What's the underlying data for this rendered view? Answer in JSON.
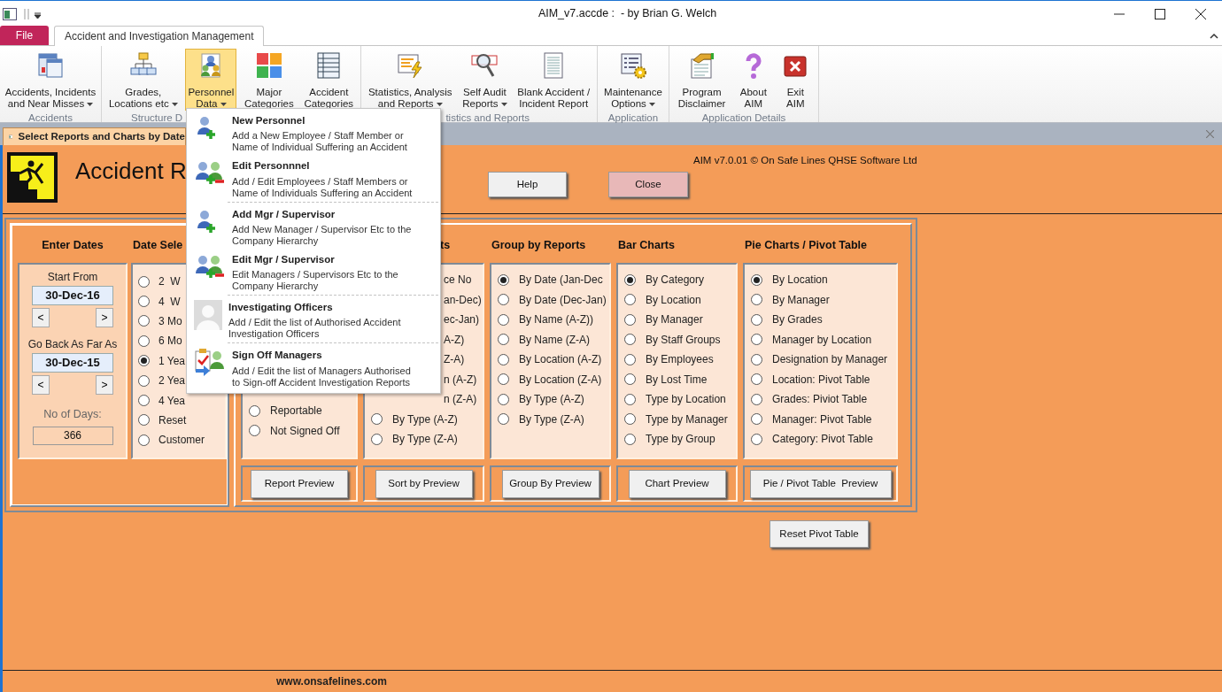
{
  "window": {
    "title": "AIM_v7.accde :  - by Brian G. Welch"
  },
  "ribbon": {
    "file_tab": "File",
    "tab": "Accident and Investigation Management",
    "groups": [
      {
        "label": "Accidents",
        "buttons": [
          {
            "lines": [
              "Accidents, Incidents",
              "and Near Misses"
            ],
            "dropdown": true,
            "selected": false
          }
        ]
      },
      {
        "label": "Structure D",
        "buttons": [
          {
            "lines": [
              "Grades,",
              "Locations etc"
            ],
            "dropdown": true,
            "selected": false
          },
          {
            "lines": [
              "Personnel",
              "Data"
            ],
            "dropdown": true,
            "selected": true,
            "menu": [
              {
                "title": "New Personnel",
                "description": [
                  "Add a New Employee / Staff Member or",
                  "Name of Individual Suffering an Accident"
                ],
                "divider": false
              },
              {
                "title": "Edit Personnnel",
                "description": [
                  "Add / Edit Employees / Staff Members or",
                  "Name of Individuals Suffering an Accident"
                ],
                "divider": true
              },
              {
                "title": "Add Mgr / Supervisor",
                "description": [
                  "Add New Manager / Supervisor Etc to the",
                  "Company Hierarchy"
                ],
                "divider": false
              },
              {
                "title": "Edit Mgr / Supervisor",
                "description": [
                  "Edit Managers / Supervisors Etc to the",
                  "Company Hierarchy"
                ],
                "divider": true
              },
              {
                "title": "Investigating Officers",
                "description": [
                  "Add / Edit the list of Authorised Accident",
                  "Investigation Officers"
                ],
                "divider": true
              },
              {
                "title": "Sign Off Managers",
                "description": [
                  "Add / Edit the list of Managers Authorised",
                  "to Sign-off Accident Investigation Reports"
                ],
                "divider": false
              }
            ]
          },
          {
            "lines": [
              "Major",
              "Categories"
            ],
            "dropdown": false,
            "selected": false
          },
          {
            "lines": [
              "Accident",
              "Categories"
            ],
            "dropdown": false,
            "selected": false
          }
        ]
      },
      {
        "label": "tistics and Reports",
        "buttons": [
          {
            "lines": [
              "Statistics, Analysis",
              "and Reports"
            ],
            "dropdown": true,
            "selected": false
          },
          {
            "lines": [
              "Self Audit",
              "Reports"
            ],
            "dropdown": true,
            "selected": false
          },
          {
            "lines": [
              "Blank Accident /",
              "Incident Report"
            ],
            "dropdown": false,
            "selected": false
          }
        ]
      },
      {
        "label": "Application",
        "buttons": [
          {
            "lines": [
              "Maintenance",
              "Options"
            ],
            "dropdown": true,
            "selected": false
          }
        ]
      },
      {
        "label": "Application Details",
        "buttons": [
          {
            "lines": [
              "Program",
              "Disclaimer"
            ],
            "dropdown": false,
            "selected": false
          },
          {
            "lines": [
              "About",
              "AIM"
            ],
            "dropdown": false,
            "selected": false
          },
          {
            "lines": [
              "Exit",
              "AIM"
            ],
            "dropdown": false,
            "selected": false
          }
        ]
      }
    ]
  },
  "subwindow": {
    "tab": "Select Reports and Charts by Date"
  },
  "form": {
    "title": "Accident R",
    "version": "AIM v7.0.01 © On Safe Lines QHSE Software Ltd",
    "help_button": "Help",
    "close_button": "Close",
    "enter_dates": {
      "heading": "Enter Dates",
      "dates": [
        {
          "label": "Start From",
          "value": "30-Dec-16",
          "prev": "<",
          "next": ">"
        },
        {
          "label": "Go Back As Far As",
          "value": "30-Dec-15",
          "prev": "<",
          "next": ">"
        }
      ],
      "days_label": "No of Days:",
      "days_value": "366"
    },
    "date_select": {
      "heading": "Date Sele",
      "options": [
        {
          "label": "2  W",
          "selected": false
        },
        {
          "label": "4  W",
          "selected": false
        },
        {
          "label": "3 Mo",
          "selected": false
        },
        {
          "label": "6 Mo",
          "selected": false
        },
        {
          "label": "1 Yea",
          "selected": true
        },
        {
          "label": "2 Yea",
          "selected": false
        },
        {
          "label": "4 Yea",
          "selected": false
        },
        {
          "label": "Reset",
          "selected": false
        },
        {
          "label": "Customer",
          "selected": false
        }
      ]
    },
    "columns": [
      {
        "options": [
          {
            "kind": "radio",
            "label": "Reportable",
            "selected": false
          },
          {
            "kind": "radio",
            "label": "Not Signed Off",
            "selected": false
          }
        ],
        "button": "Report Preview"
      },
      {
        "heading": "ts",
        "options": [
          {
            "kind": "cut",
            "label": "ce No"
          },
          {
            "kind": "cut",
            "label": "an-Dec)"
          },
          {
            "kind": "cut",
            "label": "ec-Jan)"
          },
          {
            "kind": "cut",
            "label": "A-Z)"
          },
          {
            "kind": "cut",
            "label": "Z-A)"
          },
          {
            "kind": "cut",
            "label": "n (A-Z)"
          },
          {
            "kind": "cut",
            "label": "n (Z-A)"
          },
          {
            "kind": "radio",
            "label": "By Type (A-Z)",
            "selected": false
          },
          {
            "kind": "radio",
            "label": "By Type (Z-A)",
            "selected": false
          }
        ],
        "button": "Sort by Preview"
      },
      {
        "heading": "Group by Reports",
        "options": [
          {
            "kind": "radio",
            "label": "By Date (Jan-Dec",
            "selected": true
          },
          {
            "kind": "radio",
            "label": "By Date (Dec-Jan)",
            "selected": false
          },
          {
            "kind": "radio",
            "label": "By Name (A-Z))",
            "selected": false
          },
          {
            "kind": "radio",
            "label": "By Name (Z-A)",
            "selected": false
          },
          {
            "kind": "radio",
            "label": "By Location (A-Z)",
            "selected": false
          },
          {
            "kind": "radio",
            "label": "By Location (Z-A)",
            "selected": false
          },
          {
            "kind": "radio",
            "label": "By Type (A-Z)",
            "selected": false
          },
          {
            "kind": "radio",
            "label": "By Type (Z-A)",
            "selected": false
          }
        ],
        "button": "Group By Preview"
      },
      {
        "heading": "Bar Charts",
        "options": [
          {
            "kind": "radio",
            "label": "By Category",
            "selected": true
          },
          {
            "kind": "radio",
            "label": "By Location",
            "selected": false
          },
          {
            "kind": "radio",
            "label": "By Manager",
            "selected": false
          },
          {
            "kind": "radio",
            "label": "By Staff Groups",
            "selected": false
          },
          {
            "kind": "radio",
            "label": "By Employees",
            "selected": false
          },
          {
            "kind": "radio",
            "label": "By Lost Time",
            "selected": false
          },
          {
            "kind": "radio",
            "label": "Type by Location",
            "selected": false
          },
          {
            "kind": "radio",
            "label": "Type by Manager",
            "selected": false
          },
          {
            "kind": "radio",
            "label": "Type by Group",
            "selected": false
          }
        ],
        "button": "Chart Preview"
      },
      {
        "heading": "Pie Charts / Pivot Table",
        "options": [
          {
            "kind": "radio",
            "label": "By Location",
            "selected": true
          },
          {
            "kind": "radio",
            "label": "By Manager",
            "selected": false
          },
          {
            "kind": "radio",
            "label": "By Grades",
            "selected": false
          },
          {
            "kind": "radio",
            "label": "Manager by Location",
            "selected": false
          },
          {
            "kind": "radio",
            "label": "Designation by Manager",
            "selected": false
          },
          {
            "kind": "radio",
            "label": "Location: Pivot Table",
            "selected": false
          },
          {
            "kind": "radio",
            "label": "Grades: Piviot Table",
            "selected": false
          },
          {
            "kind": "radio",
            "label": "Manager: Pivot Table",
            "selected": false
          },
          {
            "kind": "radio",
            "label": "Category: Pivot Table",
            "selected": false
          }
        ],
        "button": "Pie / Pivot Table  Preview"
      }
    ],
    "reset_button": "Reset Pivot Table",
    "footer": "www.onsafelines.com"
  }
}
